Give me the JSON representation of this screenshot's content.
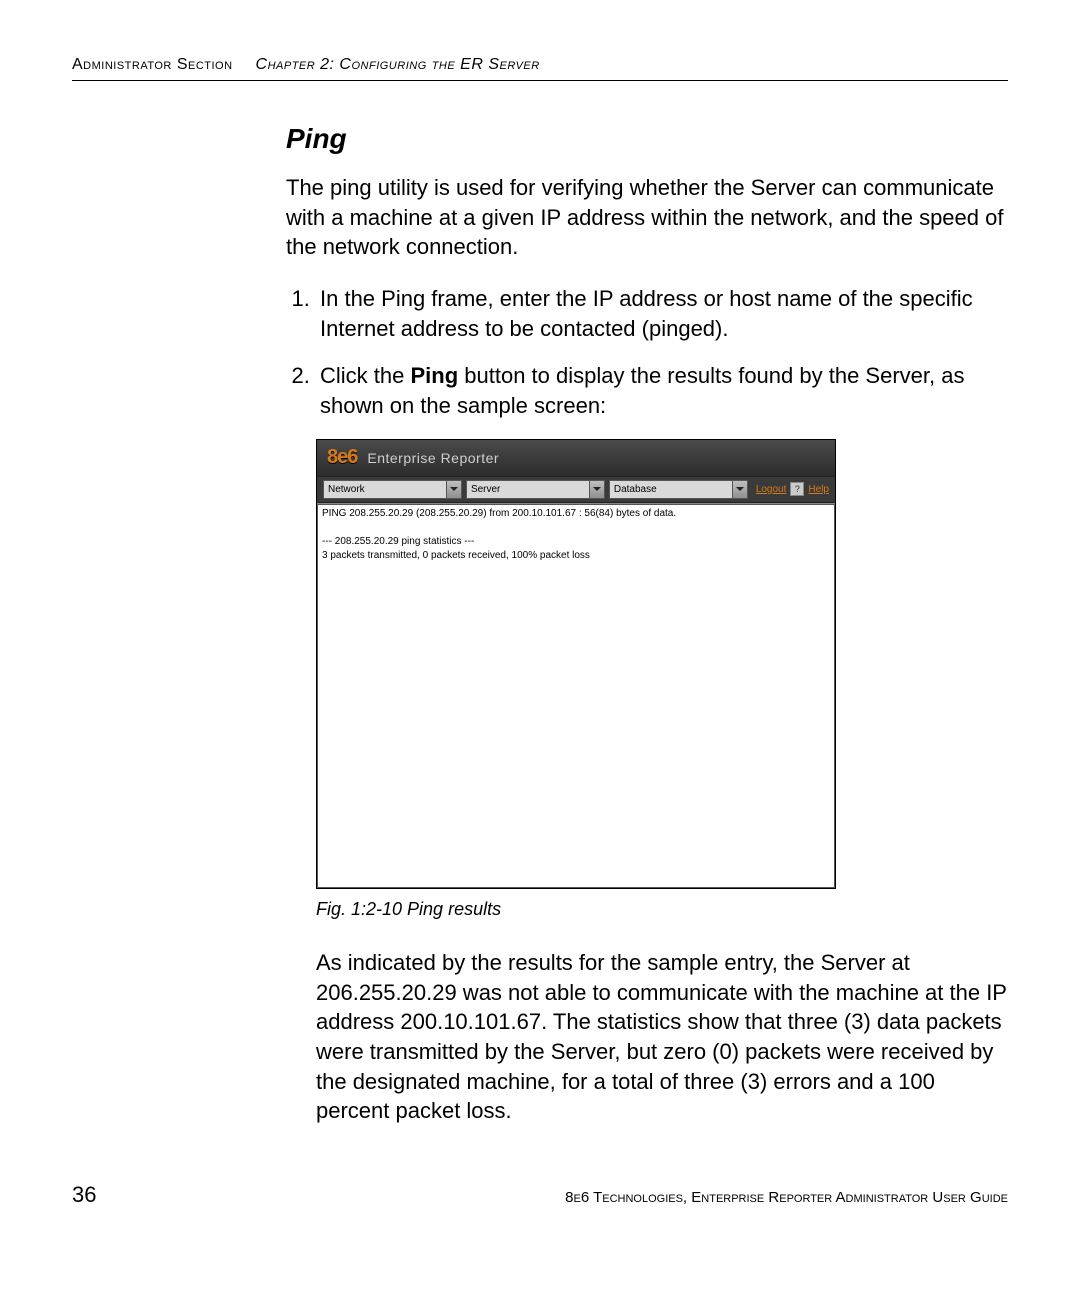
{
  "header": {
    "section_left": "Administrator Section",
    "section_right": "Chapter 2: Configuring the ER Server"
  },
  "section": {
    "title": "Ping",
    "intro": "The ping utility is used for verifying whether the Server can communicate with a machine at a given IP address within the network, and the speed of the network connection.",
    "steps": [
      "In the Ping frame, enter the IP address or host name of the specific Internet address to be contacted (pinged).",
      "Click the Ping button to display the results found by the Server, as shown on the sample screen:"
    ],
    "step2_prefix": "Click the ",
    "step2_bold": "Ping",
    "step2_suffix": " button to display the results found by the Server, as shown on the sample screen:"
  },
  "app": {
    "logo": "8e6",
    "subtitle": "Enterprise Reporter",
    "menus": {
      "network": "Network",
      "server": "Server",
      "database": "Database"
    },
    "links": {
      "logout": "Logout",
      "help": "Help",
      "question": "?"
    },
    "output": "PING 208.255.20.29 (208.255.20.29) from 200.10.101.67 : 56(84) bytes of data.\n\n--- 208.255.20.29 ping statistics ---\n3 packets transmitted, 0 packets received, 100% packet loss"
  },
  "figure": {
    "caption": "Fig. 1:2-10  Ping results"
  },
  "after_figure": "As indicated by the results for the sample entry, the Server at 206.255.20.29 was not able to communicate with the machine at the IP address 200.10.101.67. The statistics show that three (3) data packets were transmitted by the Server, but zero (0) packets were received by the designated machine, for a total of three (3) errors and a 100 percent packet loss.",
  "footer": {
    "page": "36",
    "guide": "8e6 Technologies, Enterprise Reporter Administrator User Guide"
  }
}
